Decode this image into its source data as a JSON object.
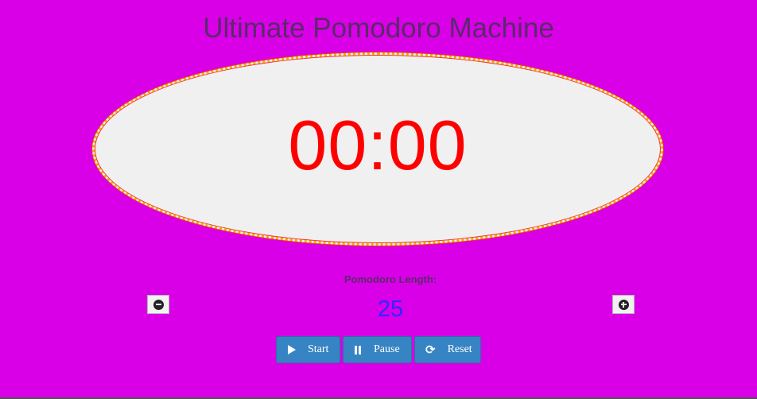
{
  "app": {
    "title": "Ultimate Pomodoro Machine"
  },
  "timer": {
    "display": "00:00"
  },
  "settings": {
    "length_label": "Pomodoro Length:",
    "length_value": "25",
    "decrement_icon": "minus-circle-icon",
    "increment_icon": "plus-circle-icon"
  },
  "controls": {
    "start_label": "Start",
    "start_icon": "play-icon",
    "pause_label": "Pause",
    "pause_icon": "pause-icon",
    "reset_label": "Reset",
    "reset_icon": "refresh-icon"
  },
  "colors": {
    "background": "#d900e8",
    "clock_face": "#f0f0f0",
    "clock_text": "#ff0000",
    "length_value": "#2a2aff",
    "button": "#3784c4",
    "title": "#5a2a6a"
  }
}
